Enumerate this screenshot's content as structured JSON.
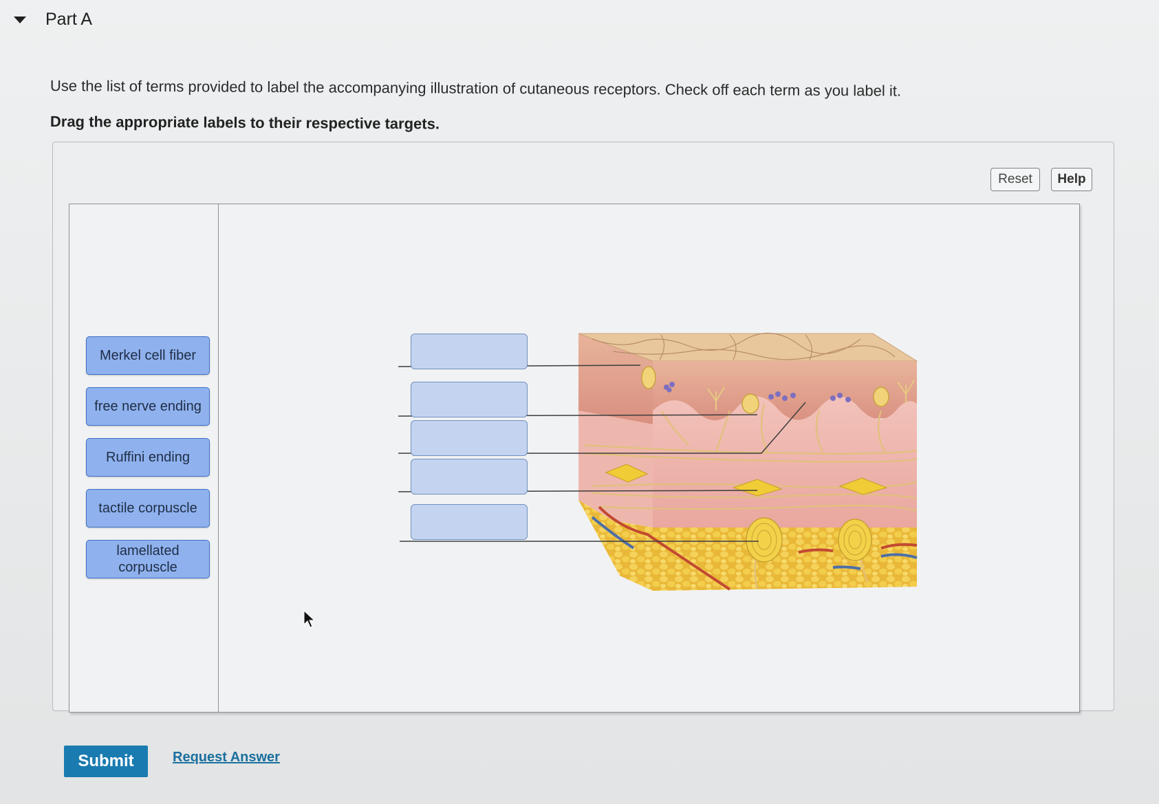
{
  "part": {
    "title": "Part A"
  },
  "instructions": "Use the list of terms provided to label the accompanying illustration of cutaneous receptors. Check off each term as you label it.",
  "drag_note": "Drag the appropriate labels to their respective targets.",
  "toolbar": {
    "reset_label": "Reset",
    "help_label": "Help"
  },
  "terms": [
    "Merkel cell fiber",
    "free nerve ending",
    "Ruffini ending",
    "tactile corpuscle",
    "lamellated corpuscle"
  ],
  "drop_targets_count": 5,
  "actions": {
    "submit_label": "Submit",
    "request_answer_label": "Request Answer"
  },
  "colors": {
    "term_fill": "#8fb2ee",
    "term_border": "#3e6fc8",
    "target_fill": "#c4d4f0",
    "submit": "#1a7bb0",
    "link": "#1a6f9e"
  },
  "icons": {
    "collapse": "caret-down-icon",
    "pointer": "mouse-pointer-icon"
  }
}
